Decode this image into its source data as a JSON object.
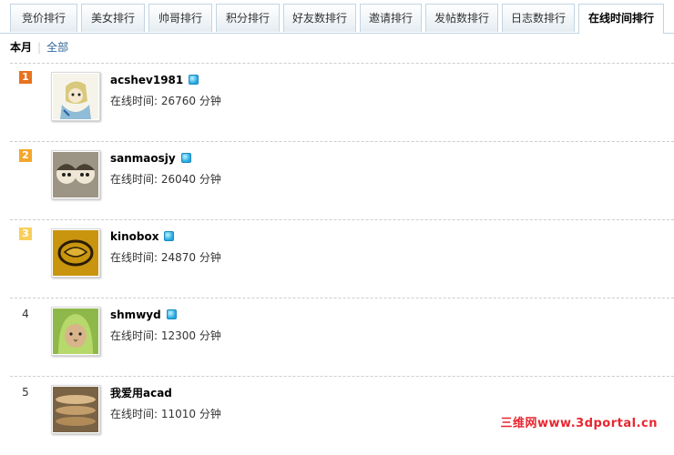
{
  "tabs": [
    {
      "label": "竞价排行",
      "active": false
    },
    {
      "label": "美女排行",
      "active": false
    },
    {
      "label": "帅哥排行",
      "active": false
    },
    {
      "label": "积分排行",
      "active": false
    },
    {
      "label": "好友数排行",
      "active": false
    },
    {
      "label": "邀请排行",
      "active": false
    },
    {
      "label": "发帖数排行",
      "active": false
    },
    {
      "label": "日志数排行",
      "active": false
    },
    {
      "label": "在线时间排行",
      "active": true
    }
  ],
  "subnav": {
    "current": "本月",
    "separator": "|",
    "other": "全部"
  },
  "ranking": [
    {
      "rank": "1",
      "username": "acshev1981",
      "online_time": "在线时间: 26760 分钟"
    },
    {
      "rank": "2",
      "username": "sanmaosjy",
      "online_time": "在线时间: 26040 分钟"
    },
    {
      "rank": "3",
      "username": "kinobox",
      "online_time": "在线时间: 24870 分钟"
    },
    {
      "rank": "4",
      "username": "shmwyd",
      "online_time": "在线时间: 12300 分钟"
    },
    {
      "rank": "5",
      "username": "我爱用acad",
      "online_time": "在线时间: 11010 分钟"
    }
  ],
  "watermark": "三维网www.3dportal.cn",
  "colors": {
    "tab_border": "#c2d5e3",
    "link": "#336699",
    "rank1": "#e8721e",
    "rank2": "#f4a72d",
    "rank3": "#f8cf5c",
    "online_icon": "#21a6e0",
    "watermark": "#e8262f"
  }
}
